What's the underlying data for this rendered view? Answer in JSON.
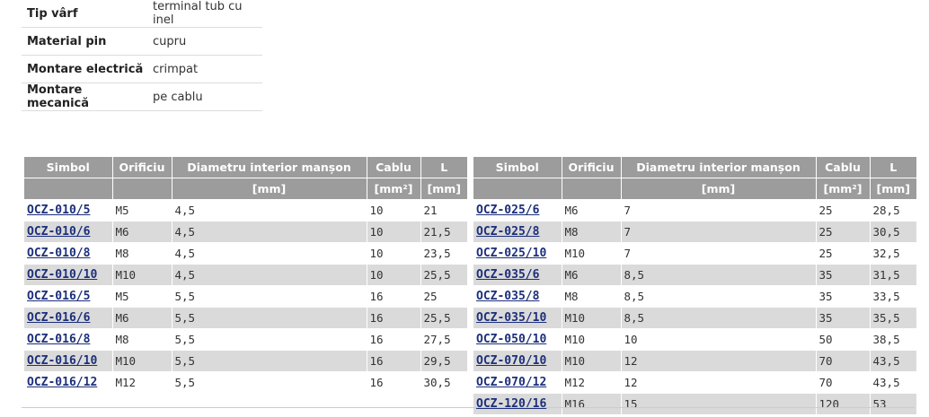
{
  "specs": [
    {
      "label": "Tip vârf",
      "value": "terminal tub cu inel"
    },
    {
      "label": "Material pin",
      "value": "cupru"
    },
    {
      "label": "Montare electrică",
      "value": "crimpat"
    },
    {
      "label": "Montare mecanică",
      "value": "pe cablu"
    }
  ],
  "table_headers": {
    "simbol": "Simbol",
    "orificiu": "Orificiu",
    "diametru": "Diametru interior manșon",
    "cablu": "Cablu",
    "l": "L",
    "unit_diametru": "[mm]",
    "unit_cablu": "[mm²]",
    "unit_l": "[mm]"
  },
  "left_rows": [
    {
      "simbol": "OCZ-010/5",
      "orificiu": "M5",
      "diametru": "4,5",
      "cablu": "10",
      "l": "21"
    },
    {
      "simbol": "OCZ-010/6",
      "orificiu": "M6",
      "diametru": "4,5",
      "cablu": "10",
      "l": "21,5"
    },
    {
      "simbol": "OCZ-010/8",
      "orificiu": "M8",
      "diametru": "4,5",
      "cablu": "10",
      "l": "23,5"
    },
    {
      "simbol": "OCZ-010/10",
      "orificiu": "M10",
      "diametru": "4,5",
      "cablu": "10",
      "l": "25,5"
    },
    {
      "simbol": "OCZ-016/5",
      "orificiu": "M5",
      "diametru": "5,5",
      "cablu": "16",
      "l": "25"
    },
    {
      "simbol": "OCZ-016/6",
      "orificiu": "M6",
      "diametru": "5,5",
      "cablu": "16",
      "l": "25,5"
    },
    {
      "simbol": "OCZ-016/8",
      "orificiu": "M8",
      "diametru": "5,5",
      "cablu": "16",
      "l": "27,5"
    },
    {
      "simbol": "OCZ-016/10",
      "orificiu": "M10",
      "diametru": "5,5",
      "cablu": "16",
      "l": "29,5"
    },
    {
      "simbol": "OCZ-016/12",
      "orificiu": "M12",
      "diametru": "5,5",
      "cablu": "16",
      "l": "30,5"
    }
  ],
  "right_rows": [
    {
      "simbol": "OCZ-025/6",
      "orificiu": "M6",
      "diametru": "7",
      "cablu": "25",
      "l": "28,5"
    },
    {
      "simbol": "OCZ-025/8",
      "orificiu": "M8",
      "diametru": "7",
      "cablu": "25",
      "l": "30,5"
    },
    {
      "simbol": "OCZ-025/10",
      "orificiu": "M10",
      "diametru": "7",
      "cablu": "25",
      "l": "32,5"
    },
    {
      "simbol": "OCZ-035/6",
      "orificiu": "M6",
      "diametru": "8,5",
      "cablu": "35",
      "l": "31,5"
    },
    {
      "simbol": "OCZ-035/8",
      "orificiu": "M8",
      "diametru": "8,5",
      "cablu": "35",
      "l": "33,5"
    },
    {
      "simbol": "OCZ-035/10",
      "orificiu": "M10",
      "diametru": "8,5",
      "cablu": "35",
      "l": "35,5"
    },
    {
      "simbol": "OCZ-050/10",
      "orificiu": "M10",
      "diametru": "10",
      "cablu": "50",
      "l": "38,5"
    },
    {
      "simbol": "OCZ-070/10",
      "orificiu": "M10",
      "diametru": "12",
      "cablu": "70",
      "l": "43,5"
    },
    {
      "simbol": "OCZ-070/12",
      "orificiu": "M12",
      "diametru": "12",
      "cablu": "70",
      "l": "43,5"
    },
    {
      "simbol": "OCZ-120/16",
      "orificiu": "M16",
      "diametru": "15",
      "cablu": "120",
      "l": "53"
    }
  ]
}
